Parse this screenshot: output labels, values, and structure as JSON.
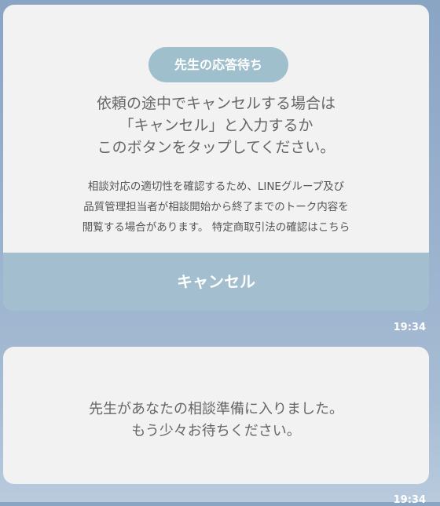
{
  "messages": [
    {
      "badge": "先生の応答待ち",
      "text_lines": [
        "依頼の途中でキャンセルする場合は",
        "「キャンセル」と入力するか",
        "このボタンをタップしてください。"
      ],
      "notice_lines": [
        "相談対応の適切性を確認するため、LINEグループ及び",
        "品質管理担当者が相談開始から終了までのトーク内容を",
        "閲覧する場合があります。 特定商取引法の確認はこちら"
      ],
      "button_label": "キャンセル",
      "time": "19:34"
    },
    {
      "text_lines": [
        "先生があなたの相談準備に入りました。",
        "もう少々お待ちください。"
      ],
      "time": "19:34"
    }
  ],
  "colors": {
    "badge_bg": "#9fbfcd",
    "button_bg": "#a3bfcf",
    "card_bg": "#f2f2f2"
  }
}
